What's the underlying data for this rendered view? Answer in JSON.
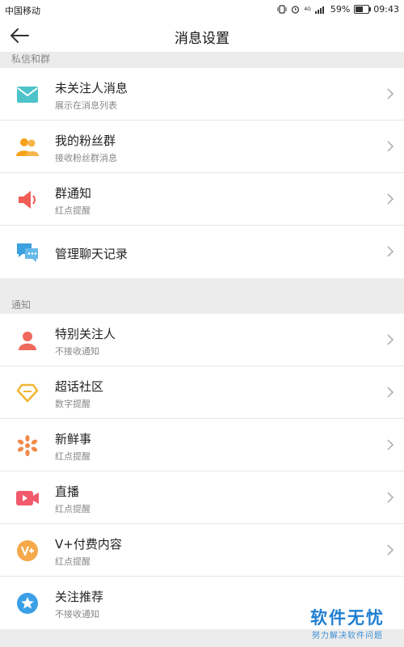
{
  "status_bar": {
    "carrier": "中国移动",
    "battery": "59%",
    "battery_level": 0.59,
    "time": "09:43",
    "network": "4G"
  },
  "nav": {
    "title": "消息设置",
    "back_icon": "arrow-left-icon"
  },
  "sections": [
    {
      "header": "私信和群",
      "items": [
        {
          "title": "未关注人消息",
          "subtitle": "展示在消息列表",
          "icon": "mail-icon",
          "color": "#4ec3c9"
        },
        {
          "title": "我的粉丝群",
          "subtitle": "接收粉丝群消息",
          "icon": "group-icon",
          "color": "#f7a21c"
        },
        {
          "title": "群通知",
          "subtitle": "红点提醒",
          "icon": "speaker-icon",
          "color": "#ef5d55"
        },
        {
          "title": "管理聊天记录",
          "subtitle": "",
          "icon": "chat-icon",
          "color": "#3aa0df"
        }
      ]
    },
    {
      "header": "通知",
      "items": [
        {
          "title": "特别关注人",
          "subtitle": "不接收通知",
          "icon": "person-icon",
          "color": "#ef6a5c"
        },
        {
          "title": "超话社区",
          "subtitle": "数字提醒",
          "icon": "diamond-icon",
          "color": "#f2b632"
        },
        {
          "title": "新鲜事",
          "subtitle": "红点提醒",
          "icon": "flower-icon",
          "color": "#f08a4b"
        },
        {
          "title": "直播",
          "subtitle": "红点提醒",
          "icon": "video-icon",
          "color": "#f05a6b"
        },
        {
          "title": "V+付费内容",
          "subtitle": "红点提醒",
          "icon": "vplus-icon",
          "color": "#f5a94b"
        },
        {
          "title": "关注推荐",
          "subtitle": "不接收通知",
          "icon": "star-badge-icon",
          "color": "#3b9fe6"
        }
      ]
    }
  ],
  "watermark": {
    "main": "软件无忧",
    "sub": "努力解决软件问题"
  }
}
